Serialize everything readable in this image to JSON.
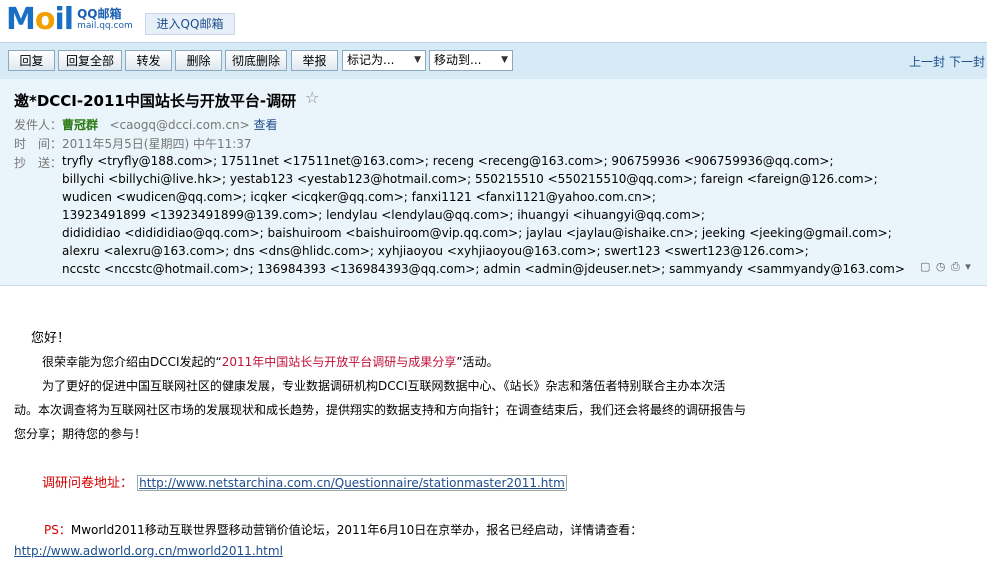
{
  "top": {
    "logo_text": "Mail",
    "logo_sub_big": "QQ邮箱",
    "logo_sub_small": "mail.qq.com",
    "enter_label": "进入QQ邮箱"
  },
  "toolbar": {
    "reply": "回复",
    "reply_all": "回复全部",
    "forward": "转发",
    "delete": "删除",
    "perm_delete": "彻底删除",
    "report": "举报",
    "mark_as": "标记为...",
    "move_to": "移动到...",
    "prev": "上一封",
    "next": "下一封"
  },
  "mail": {
    "subject": "邀*DCCI-2011中国站长与开放平台-调研",
    "sender_label": "发件人：",
    "sender_name": "曹冠群",
    "sender_addr": "<caogq@dcci.com.cn>",
    "view_label": "查看",
    "time_label": "时　间：",
    "time_value": "2011年5月5日(星期四) 中午11:37",
    "cc_label": "抄　送：",
    "cc_lines": [
      "tryfly <tryfly@188.com>; 17511net <17511net@163.com>; receng <receng@163.com>; 906759936 <906759936@qq.com>;",
      "billychi <billychi@live.hk>; yestab123 <yestab123@hotmail.com>; 550215510 <550215510@qq.com>; fareign <fareign@126.com>;",
      "wudicen <wudicen@qq.com>; icqker <icqker@qq.com>; fanxi1121 <fanxi1121@yahoo.com.cn>;",
      "13923491899 <13923491899@139.com>; lendylau <lendylau@qq.com>; ihuangyi <ihuangyi@qq.com>;",
      "didididiao <didididiao@qq.com>; baishuiroom <baishuiroom@vip.qq.com>; jaylau <jaylau@ishaike.cn>; jeeking <jeeking@gmail.com>;",
      "alexru <alexru@163.com>; dns <dns@hlidc.com>; xyhjiaoyou <xyhjiaoyou@163.com>; swert123 <swert123@126.com>;",
      "nccstc <nccstc@hotmail.com>; 136984393 <136984393@qq.com>; admin <admin@jdeuser.net>; sammyandy <sammyandy@163.com>"
    ],
    "tool_icons": "▢ ◷ ⎙ ▾"
  },
  "content": {
    "greeting": "您好！",
    "p1_pre": "很荣幸能为您介绍由DCCI发起的“",
    "p1_hl": "2011年中国站长与开放平台调研与成果分享",
    "p1_post": "”活动。",
    "p2_line1": "为了更好的促进中国互联网社区的健康发展，专业数据调研机构DCCI互联网数据中心、《站长》杂志和落伍者特别联合主办本次活",
    "p2_line2": "动。本次调查将为互联网社区市场的发展现状和成长趋势，提供翔实的数据支持和方向指针；在调查结束后，我们还会将最终的调研报告与",
    "p2_line3": "您分享；期待您的参与！",
    "survey_label": "调研问卷地址：",
    "survey_url": "http://www.netstarchina.com.cn/Questionnaire/stationmaster2011.htm",
    "ps_label": "PS：",
    "ps_text": "Mworld2011移动互联世界暨移动营销价值论坛，2011年6月10日在京举办，报名已经启动，详情请查看：",
    "ps_url": "http://www.adworld.org.cn/mworld2011.html"
  }
}
